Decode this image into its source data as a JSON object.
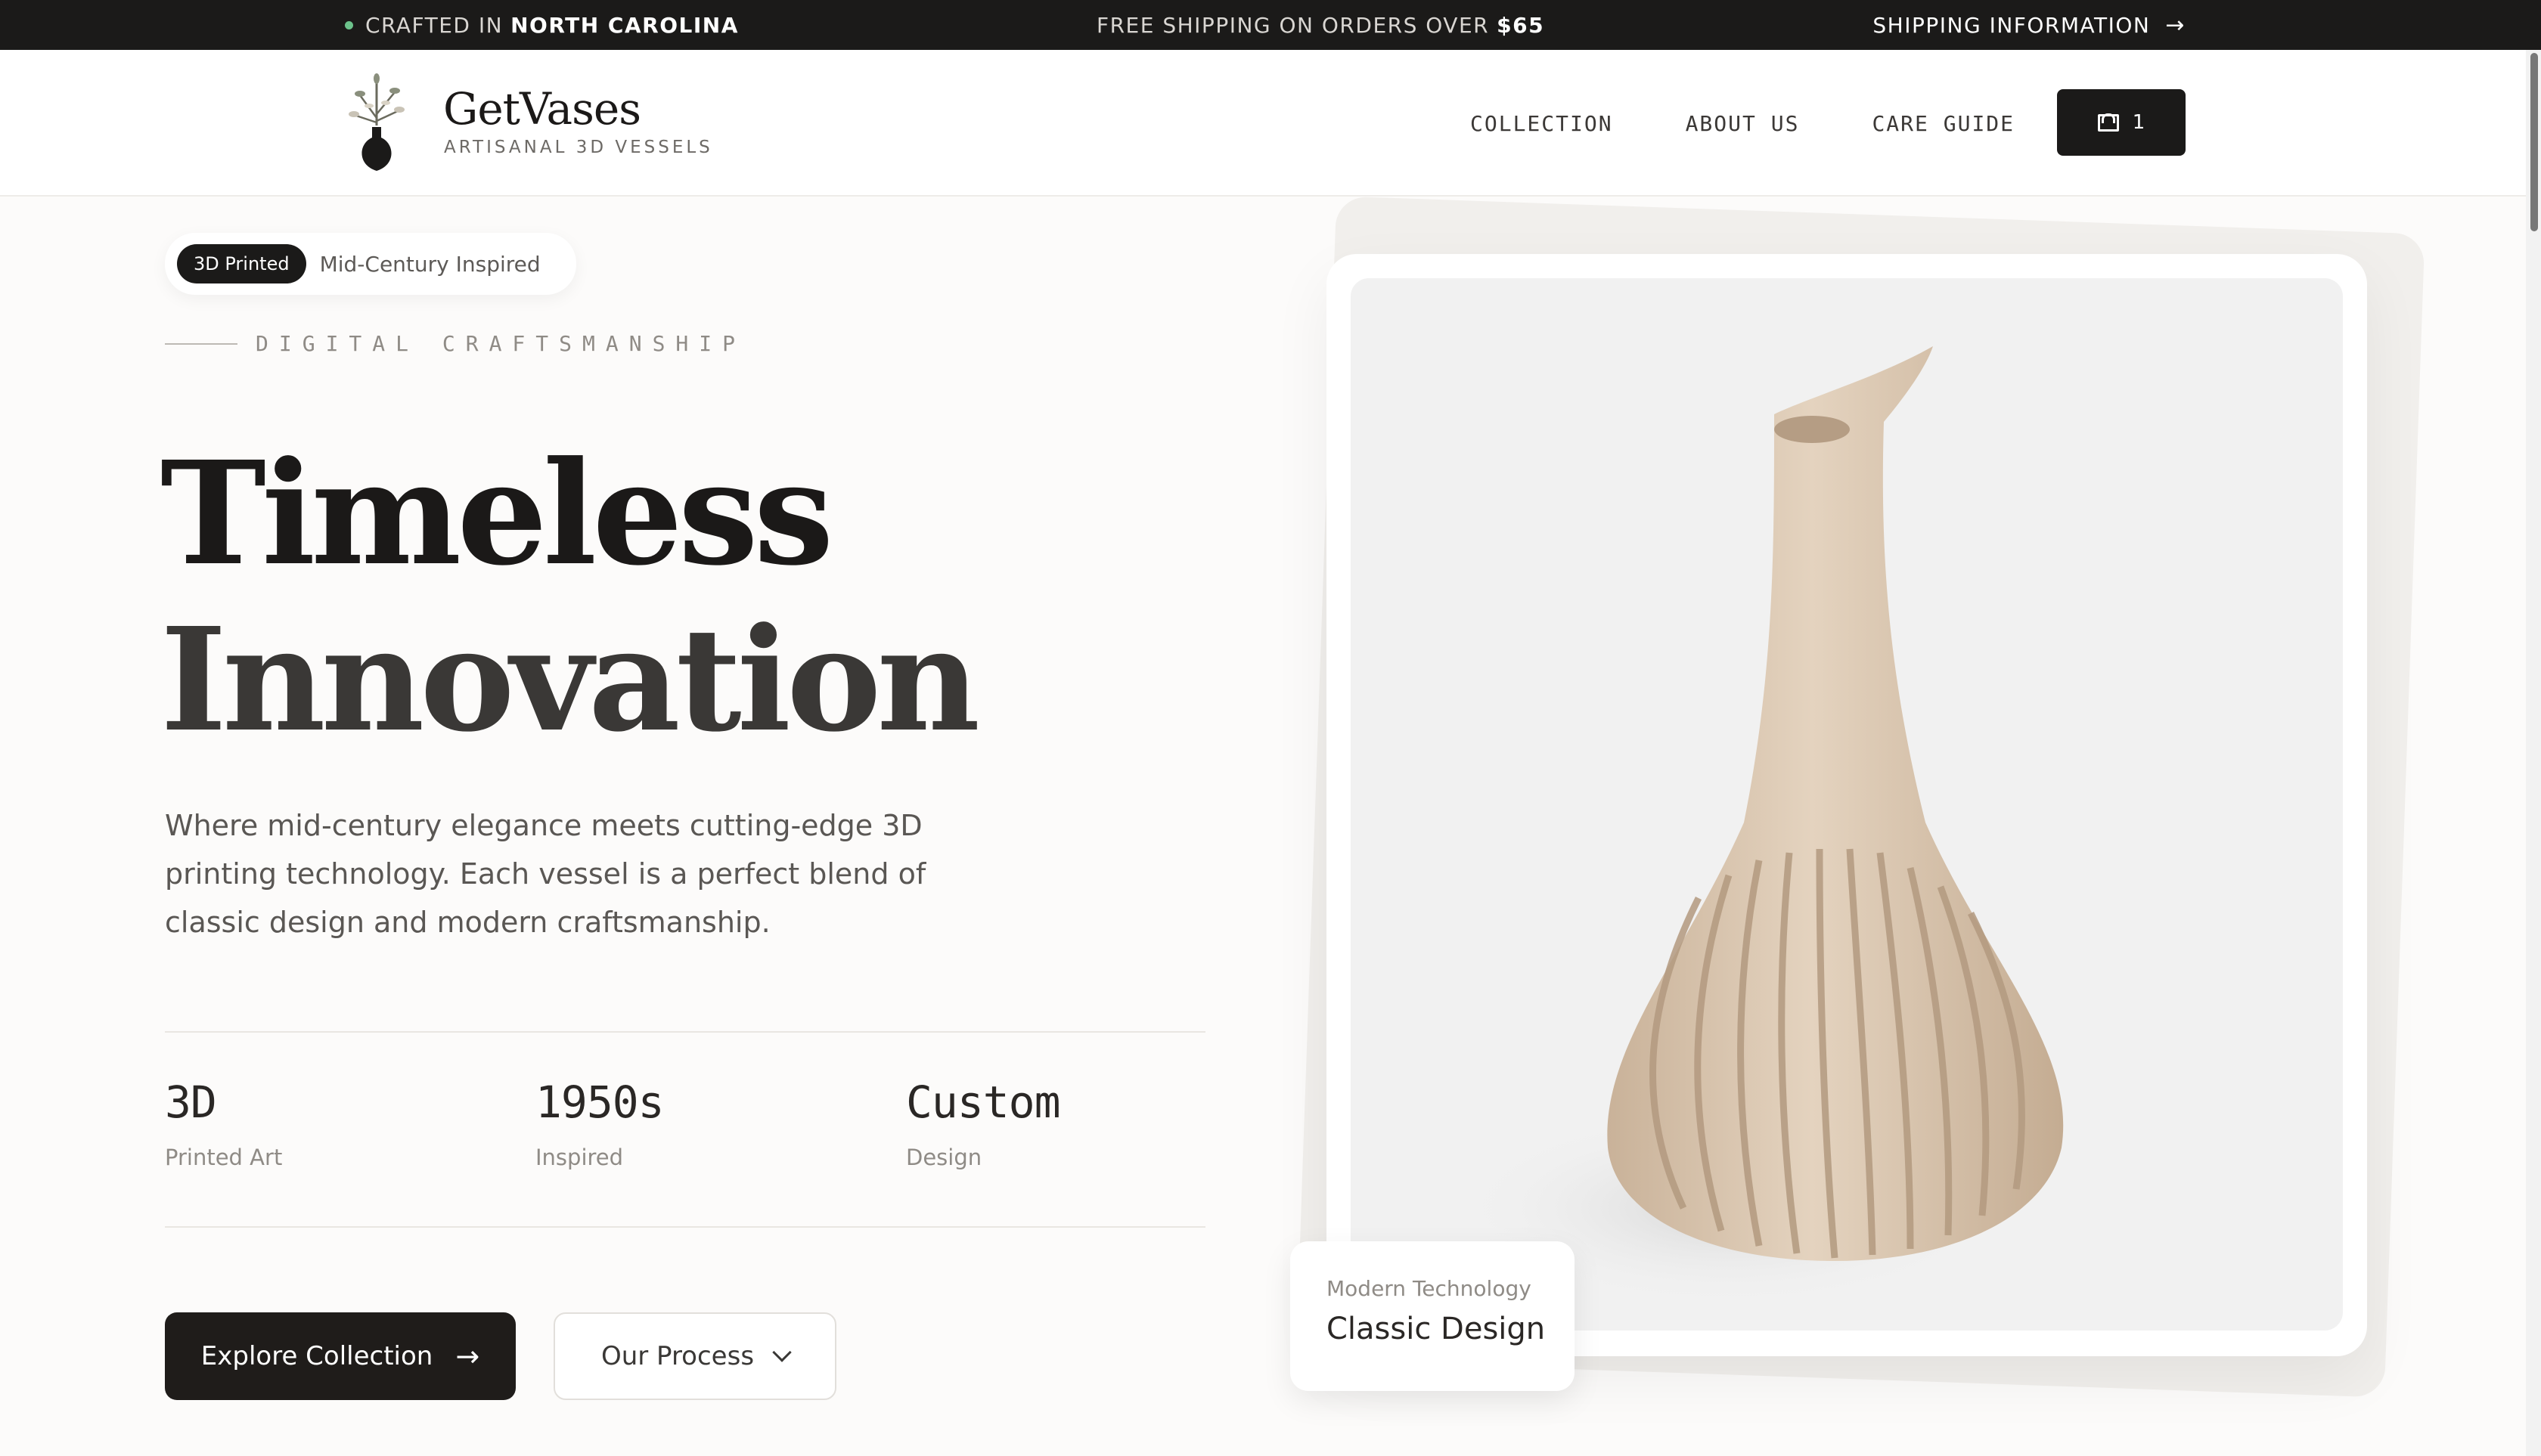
{
  "topbar": {
    "crafted_prefix": "CRAFTED IN",
    "crafted_location": "NORTH CAROLINA",
    "shipping_prefix": "FREE SHIPPING ON ORDERS OVER",
    "shipping_amount": "$65",
    "shipping_info_label": "SHIPPING INFORMATION",
    "status_dot_color": "#6cc28b"
  },
  "brand": {
    "name": "GetVases",
    "tagline": "ARTISANAL 3D VESSELS",
    "logo_icon": "vase-with-branches-icon"
  },
  "nav": {
    "items": [
      {
        "label": "COLLECTION"
      },
      {
        "label": "ABOUT US"
      },
      {
        "label": "CARE GUIDE"
      }
    ],
    "cart_count": "1",
    "cart_icon": "shopping-bag-icon"
  },
  "hero": {
    "badge_primary": "3D Printed",
    "badge_secondary": "Mid-Century Inspired",
    "eyebrow": "DIGITAL CRAFTSMANSHIP",
    "title_line1": "Timeless",
    "title_line2": "Innovation",
    "subcopy": "Where mid-century elegance meets cutting-edge 3D printing technology. Each vessel is a perfect blend of classic design and modern craftsmanship.",
    "stats": [
      {
        "value": "3D",
        "label": "Printed Art"
      },
      {
        "value": "1950s",
        "label": "Inspired"
      },
      {
        "value": "Custom",
        "label": "Design"
      }
    ],
    "primary_button": "Explore Collection",
    "secondary_button": "Our Process"
  },
  "feature_card": {
    "small": "Modern Technology",
    "big": "Classic Design"
  },
  "colors": {
    "dark": "#1b1a19",
    "vase": "#dccab4",
    "background": "#fcfbfa"
  }
}
